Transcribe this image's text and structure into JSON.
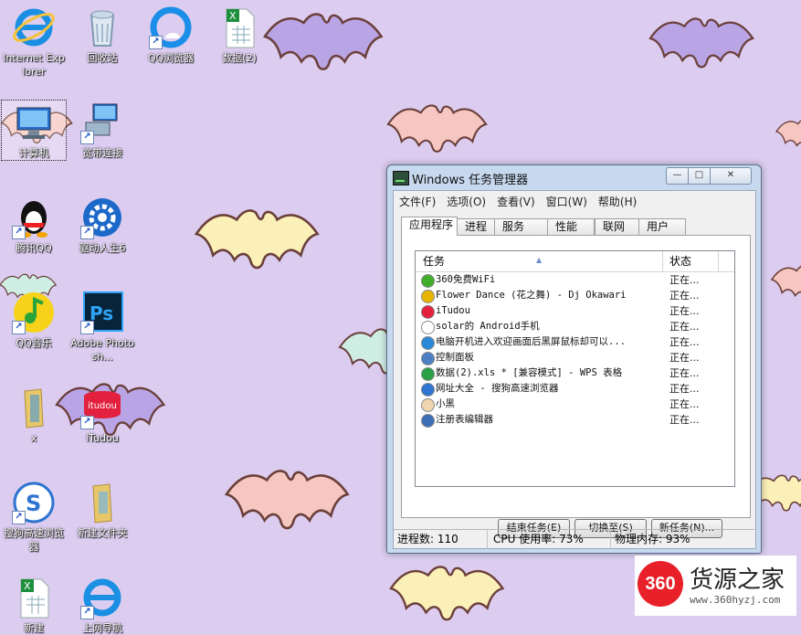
{
  "desktop": {
    "icons": [
      {
        "label": "Internet Explorer",
        "icon": "ie-icon",
        "shortcut": false
      },
      {
        "label": "回收站",
        "icon": "recycle-bin-icon",
        "shortcut": false
      },
      {
        "label": "QQ浏览器",
        "icon": "qq-browser-icon",
        "shortcut": true
      },
      {
        "label": "数据(2)",
        "icon": "spreadsheet-icon",
        "shortcut": false
      },
      {
        "label": "计算机",
        "icon": "computer-icon",
        "shortcut": false
      },
      {
        "label": "宽带连接",
        "icon": "network-icon",
        "shortcut": true
      },
      {
        "label": "腾讯QQ",
        "icon": "qq-penguin-icon",
        "shortcut": true
      },
      {
        "label": "驱动人生6",
        "icon": "driver-icon",
        "shortcut": true
      },
      {
        "label": "QQ音乐",
        "icon": "qq-music-icon",
        "shortcut": true
      },
      {
        "label": "Adobe Photosh...",
        "icon": "photoshop-icon",
        "shortcut": true
      },
      {
        "label": "x",
        "icon": "folder-icon",
        "shortcut": false
      },
      {
        "label": "iTudou",
        "icon": "itudou-icon",
        "shortcut": true
      },
      {
        "label": "搜狗高速浏览器",
        "icon": "sogou-browser-icon",
        "shortcut": true
      },
      {
        "label": "新建文件夹",
        "icon": "folder-icon",
        "shortcut": false
      },
      {
        "label": "新建",
        "icon": "spreadsheet-icon",
        "shortcut": false
      },
      {
        "label": "上网导航",
        "icon": "ie-icon",
        "shortcut": true
      }
    ]
  },
  "window": {
    "title": "Windows 任务管理器",
    "controls": {
      "minimize": "—",
      "maximize": "□",
      "close": "✕"
    },
    "menu": [
      "文件(F)",
      "选项(O)",
      "查看(V)",
      "窗口(W)",
      "帮助(H)"
    ],
    "tabs": [
      "应用程序",
      "进程",
      "服务",
      "性能",
      "联网",
      "用户"
    ],
    "active_tab": "应用程序",
    "columns": {
      "task": "任务",
      "status": "状态"
    },
    "rows": [
      {
        "name": "360免费WiFi",
        "status": "正在...",
        "color": "#3fae2a"
      },
      {
        "name": "Flower Dance (花之舞) - Dj Okawari",
        "status": "正在...",
        "color": "#e8b400"
      },
      {
        "name": "iTudou",
        "status": "正在...",
        "color": "#e3203d"
      },
      {
        "name": "solar的 Android手机",
        "status": "正在...",
        "color": "#ffffff"
      },
      {
        "name": "电脑开机进入欢迎画面后黑屏鼠标却可以...",
        "status": "正在...",
        "color": "#2a8ad8"
      },
      {
        "name": "控制面板",
        "status": "正在...",
        "color": "#4d7fc4"
      },
      {
        "name": "数据(2).xls * [兼容模式] - WPS 表格",
        "status": "正在...",
        "color": "#2aa147"
      },
      {
        "name": "网址大全 - 搜狗高速浏览器",
        "status": "正在...",
        "color": "#2f74d0"
      },
      {
        "name": "小黑",
        "status": "正在...",
        "color": "#f0d6b0"
      },
      {
        "name": "注册表编辑器",
        "status": "正在...",
        "color": "#3c6fb5"
      }
    ],
    "buttons": {
      "end_task": "结束任务(E)",
      "switch_to": "切换至(S)",
      "new_task": "新任务(N)..."
    },
    "status": {
      "processes": "进程数: 110",
      "cpu": "CPU 使用率: 73%",
      "memory": "物理内存: 93%"
    }
  },
  "watermark": {
    "badge": "360",
    "name": "货源之家",
    "url": "www.360hyzj.com"
  },
  "colors": {
    "wallpaper": "#dccdf0",
    "bat_purple": "#b9a5e6",
    "bat_pink": "#f6c7c0",
    "bat_yellow": "#fbf1b8",
    "bat_mint": "#cfeee3"
  }
}
